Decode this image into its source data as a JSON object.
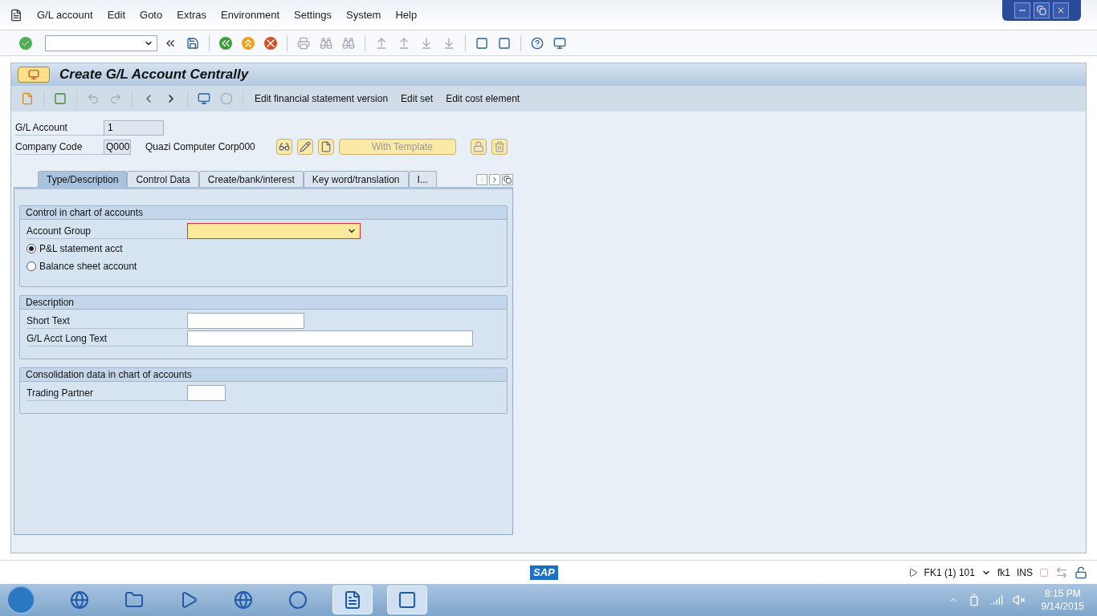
{
  "menu": [
    "G/L account",
    "Edit",
    "Goto",
    "Extras",
    "Environment",
    "Settings",
    "System",
    "Help"
  ],
  "title": "Create G/L Account Centrally",
  "app_toolbar": [
    "Edit financial statement version",
    "Edit set",
    "Edit cost element"
  ],
  "header": {
    "gl_account": {
      "label": "G/L Account",
      "value": "1"
    },
    "company_code": {
      "label": "Company Code",
      "value": "Q000",
      "name": "Quazi Computer Corp000"
    },
    "template_button": "With Template"
  },
  "tabs": [
    {
      "label": "Type/Description",
      "selected": true
    },
    {
      "label": "Control Data",
      "selected": false
    },
    {
      "label": "Create/bank/interest",
      "selected": false
    },
    {
      "label": "Key word/translation",
      "selected": false
    },
    {
      "label": "I...",
      "selected": false
    }
  ],
  "groups": [
    {
      "title": "Control in chart of accounts",
      "rows": [
        {
          "kind": "dropdown",
          "label": "Account Group",
          "required": true
        },
        {
          "kind": "radio",
          "label": "P&L statement acct",
          "selected": true
        },
        {
          "kind": "radio",
          "label": "Balance sheet account",
          "selected": false
        }
      ]
    },
    {
      "title": "Description",
      "rows": [
        {
          "kind": "input",
          "label": "Short Text"
        },
        {
          "kind": "wide_input",
          "label": "G/L Acct Long Text"
        }
      ]
    },
    {
      "title": "Consolidation data in chart of accounts",
      "rows": [
        {
          "kind": "small_input",
          "label": "Trading Partner"
        }
      ]
    }
  ],
  "status_bar": {
    "logo": "SAP",
    "session": "FK1 (1) 101",
    "transaction": "fk1",
    "mode": "INS"
  },
  "taskbar": {
    "apps": [
      {
        "kind": "browser",
        "open": false
      },
      {
        "kind": "folder",
        "open": false
      },
      {
        "kind": "media",
        "open": false
      },
      {
        "kind": "globe",
        "open": false
      },
      {
        "kind": "chrome",
        "open": false
      },
      {
        "kind": "word",
        "open": true
      },
      {
        "kind": "sap",
        "open": true
      }
    ],
    "time": "8:15 PM",
    "date": "9/14/2015"
  }
}
